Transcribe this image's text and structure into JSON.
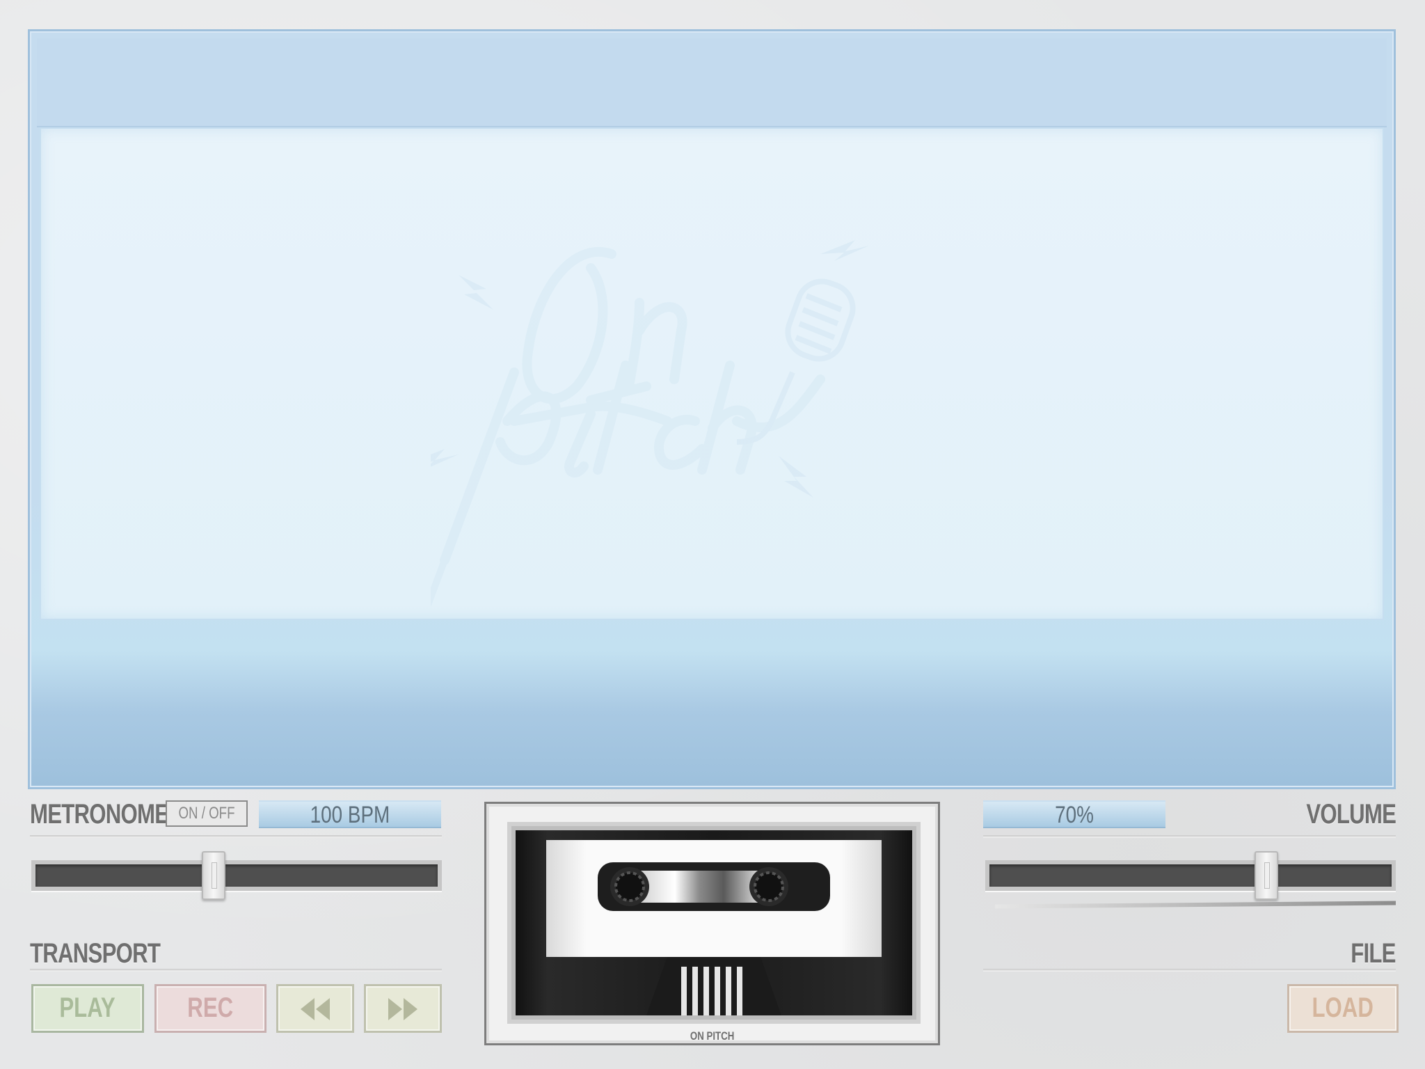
{
  "app": {
    "brand": "On Pitch",
    "cassette_label": "ON PITCH"
  },
  "metronome": {
    "label": "METRONOME",
    "toggle_label": "ON / OFF",
    "bpm_readout": "100 BPM",
    "bpm_slider_fraction": 0.44
  },
  "volume": {
    "label": "VOLUME",
    "readout": "70%",
    "slider_fraction": 0.7
  },
  "transport": {
    "label": "TRANSPORT",
    "play_label": "PLAY",
    "rec_label": "REC",
    "rewind_icon": "rewind-icon",
    "fast_forward_icon": "fast-forward-icon"
  },
  "file": {
    "label": "FILE",
    "load_label": "LOAD"
  },
  "colors": {
    "display_blue": "#c5dcef",
    "play_green": "#dfe9d6",
    "rec_red": "#ecdcdc",
    "load_orange": "#ece0d5",
    "slider_track": "#4f4f4f"
  }
}
